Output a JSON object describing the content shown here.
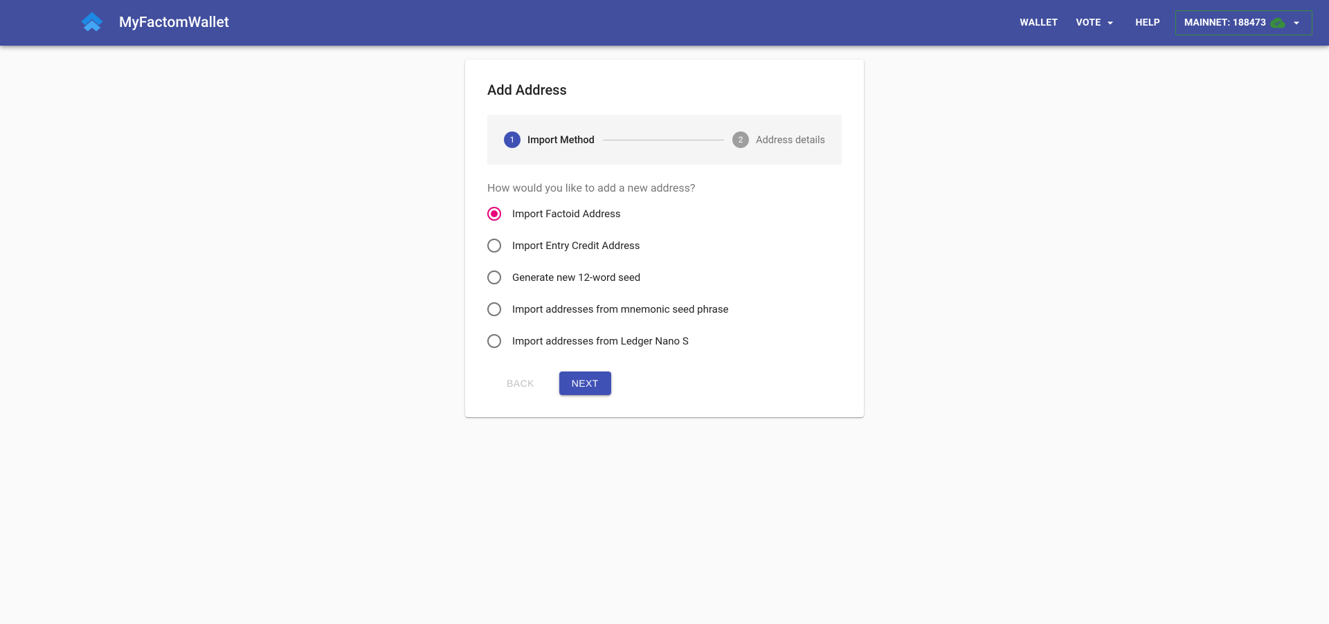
{
  "header": {
    "title": "MyFactomWallet",
    "nav": {
      "wallet": "Wallet",
      "vote": "Vote",
      "help": "Help"
    },
    "network_label": "Mainnet: 188473"
  },
  "card": {
    "title": "Add Address",
    "stepper": {
      "step1_num": "1",
      "step1_label": "Import Method",
      "step2_num": "2",
      "step2_label": "Address details"
    },
    "prompt": "How would you like to add a new address?",
    "options": [
      {
        "label": "Import Factoid Address",
        "selected": true
      },
      {
        "label": "Import Entry Credit Address",
        "selected": false
      },
      {
        "label": "Generate new 12-word seed",
        "selected": false
      },
      {
        "label": "Import addresses from mnemonic seed phrase",
        "selected": false
      },
      {
        "label": "Import addresses from Ledger Nano S",
        "selected": false
      }
    ],
    "back_label": "Back",
    "next_label": "Next"
  }
}
